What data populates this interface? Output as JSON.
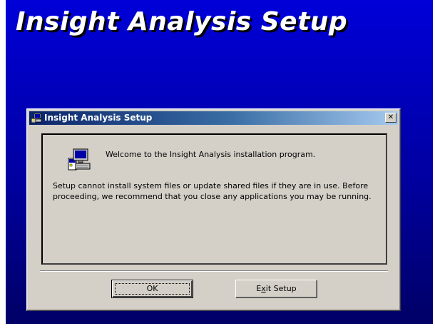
{
  "banner": {
    "title": "Insight Analysis Setup"
  },
  "dialog": {
    "title": "Insight Analysis Setup",
    "close_label": "✕",
    "welcome": "Welcome to the Insight Analysis installation program.",
    "body": "Setup cannot install system files or update shared files if they are in use. Before proceeding, we recommend that you close any applications you may be running.",
    "buttons": {
      "ok_label": "OK",
      "exit_prefix": "E",
      "exit_mnemonic": "x",
      "exit_suffix": "it Setup"
    }
  },
  "colors": {
    "background_blue": "#0000d8",
    "titlebar_start": "#0a246a",
    "titlebar_end": "#a6caf0",
    "dialog_face": "#d4d0c8"
  },
  "icons": {
    "title_icon": "setup-computer-icon",
    "main_icon": "computer-setup-icon"
  }
}
